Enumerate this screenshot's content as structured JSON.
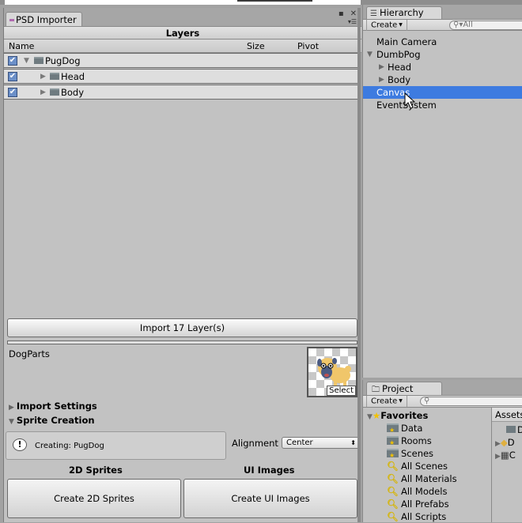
{
  "psd_importer": {
    "tab_title": "PSD Importer",
    "layers_header": "Layers",
    "columns": {
      "name": "Name",
      "size": "Size",
      "pivot": "Pivot"
    },
    "layers": [
      {
        "name": "PugDog",
        "checked": true,
        "expanded": true,
        "depth": 0
      },
      {
        "name": "Head",
        "checked": true,
        "expanded": false,
        "depth": 1
      },
      {
        "name": "Body",
        "checked": true,
        "expanded": false,
        "depth": 1
      }
    ],
    "import_button": "Import 17 Layer(s)",
    "asset_name": "DogParts",
    "select_label": "Select",
    "import_settings_label": "Import Settings",
    "sprite_creation_label": "Sprite Creation",
    "help_message": "Creating: PugDog",
    "alignment_label": "Alignment",
    "alignment_value": "Center",
    "sprites_header": "2D Sprites",
    "ui_images_header": "UI Images",
    "create_sprites_button": "Create 2D Sprites",
    "create_ui_images_button": "Create UI Images"
  },
  "hierarchy": {
    "tab_title": "Hierarchy",
    "create_label": "Create",
    "search_placeholder": "All",
    "items": [
      {
        "label": "Main Camera",
        "selected": false
      },
      {
        "label": "DumbPog",
        "selected": false,
        "expanded": true
      },
      {
        "label": "Head",
        "selected": false,
        "expanded": false
      },
      {
        "label": "Body",
        "selected": false,
        "expanded": false
      },
      {
        "label": "Canvas",
        "selected": true
      },
      {
        "label": "EventSystem",
        "selected": false
      }
    ],
    "selection_color": "#3d7be0"
  },
  "project": {
    "tab_title": "Project",
    "create_label": "Create",
    "favorites_label": "Favorites",
    "favorites": [
      {
        "label": "Data",
        "icon": "favorite-folder-icon"
      },
      {
        "label": "Rooms",
        "icon": "favorite-folder-icon"
      },
      {
        "label": "Scenes",
        "icon": "favorite-folder-icon"
      },
      {
        "label": "All Scenes",
        "icon": "search-icon"
      },
      {
        "label": "All Materials",
        "icon": "search-icon"
      },
      {
        "label": "All Models",
        "icon": "search-icon"
      },
      {
        "label": "All Prefabs",
        "icon": "search-icon"
      },
      {
        "label": "All Scripts",
        "icon": "search-icon"
      }
    ],
    "assets_label": "Assets",
    "asset_items": [
      "D",
      "D",
      "C"
    ]
  }
}
